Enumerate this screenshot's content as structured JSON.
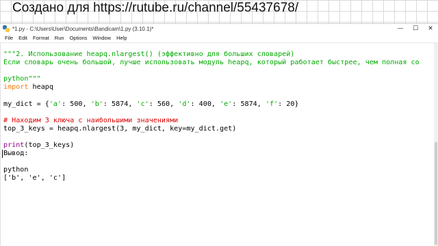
{
  "banner": {
    "text": "Создано для https://rutube.ru/channel/55437678/"
  },
  "window": {
    "title": "*1.py - C:\\Users\\User\\Documents\\Bandicam\\1.py (3.10.1)*",
    "controls": {
      "minimize": "—",
      "maximize": "☐",
      "close": "✕"
    }
  },
  "menu": {
    "items": [
      "File",
      "Edit",
      "Format",
      "Run",
      "Options",
      "Window",
      "Help"
    ]
  },
  "code": {
    "line1": "\"\"\"2. Использование heapq.nlargest() (эффективно для больших словарей)",
    "line2": "Если словарь очень большой, лучше использовать модуль heapq, который работает быстрее, чем полная со",
    "line3": "python\"\"\"",
    "line4_kw": "import",
    "line4_rest": " heapq",
    "line5": "my_dict = {",
    "d_a_k": "'a'",
    "d_a_v": ": 500, ",
    "d_b_k": "'b'",
    "d_b_v": ": 5874, ",
    "d_c_k": "'c'",
    "d_c_v": ": 560, ",
    "d_d_k": "'d'",
    "d_d_v": ": 400, ",
    "d_e_k": "'e'",
    "d_e_v": ": 5874, ",
    "d_f_k": "'f'",
    "d_f_v": ": 20}",
    "comment": "# Находим 3 ключа с наибольшими значениями",
    "line7": "top_3_keys = heapq.nlargest(3, my_dict, key=my_dict.get)",
    "print_kw": "print",
    "print_rest": "(top_3_keys)",
    "output_label": "Вывод:",
    "out_python": "python",
    "out_list": "['b', 'e', 'c']"
  },
  "colors": {
    "string": "#00aa00",
    "keyword": "#ff7700",
    "builtin": "#900090",
    "comment": "#dd0000"
  }
}
